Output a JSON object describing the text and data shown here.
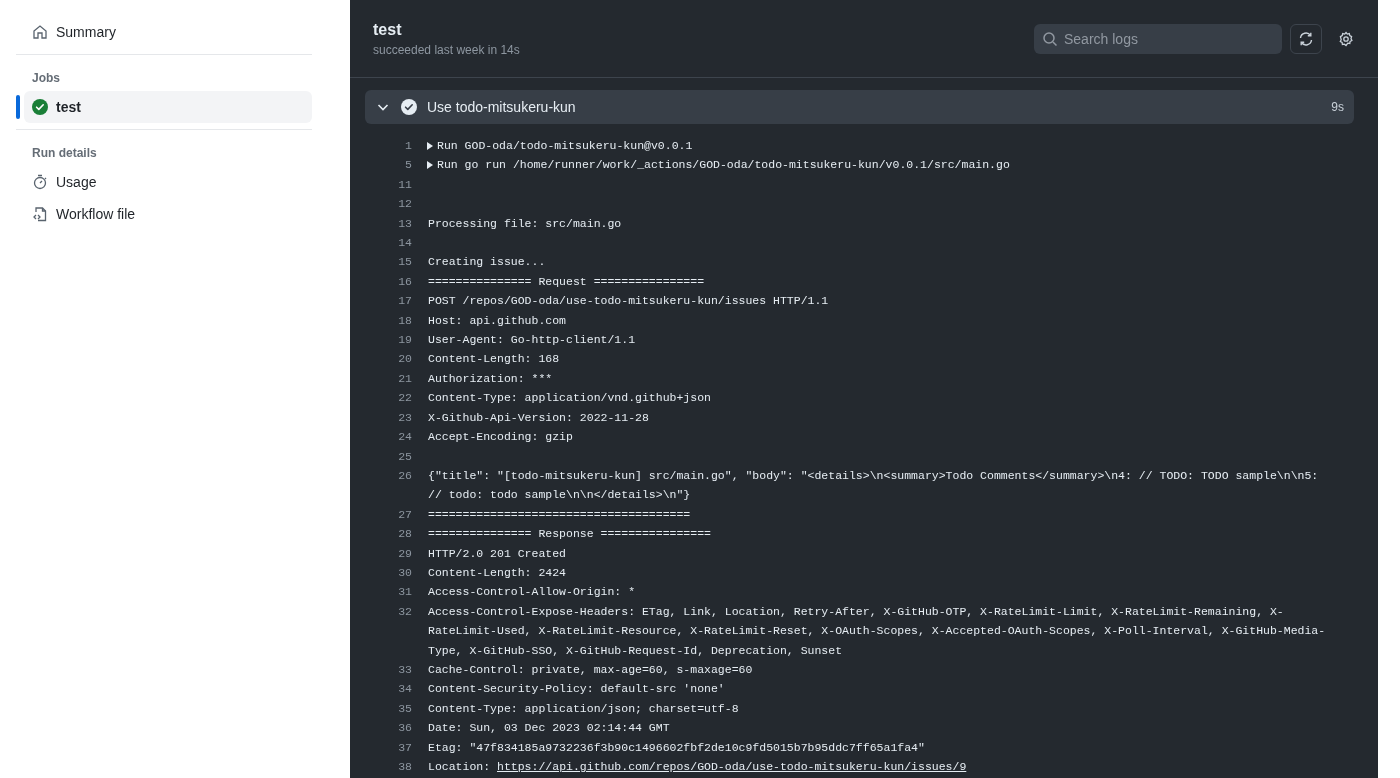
{
  "sidebar": {
    "summary": "Summary",
    "jobs_heading": "Jobs",
    "jobs": [
      {
        "label": "test",
        "selected": true
      }
    ],
    "run_details_heading": "Run details",
    "details": [
      {
        "label": "Usage",
        "kind": "stopwatch"
      },
      {
        "label": "Workflow file",
        "kind": "file"
      }
    ]
  },
  "header": {
    "title": "test",
    "subtitle": "succeeded last week in 14s",
    "search": {
      "placeholder": "Search logs"
    }
  },
  "step": {
    "name": "Use todo-mitsukeru-kun",
    "duration": "9s",
    "expanded": true
  },
  "log": [
    {
      "num": "1",
      "kind": "group",
      "text": "Run GOD-oda/todo-mitsukeru-kun@v0.0.1"
    },
    {
      "num": "5",
      "kind": "group",
      "text": "Run go run /home/runner/work/_actions/GOD-oda/todo-mitsukeru-kun/v0.0.1/src/main.go"
    },
    {
      "num": "11",
      "kind": "line"
    },
    {
      "num": "12",
      "kind": "line"
    },
    {
      "num": "13",
      "kind": "line",
      "text": "Processing file: src/main.go"
    },
    {
      "num": "14",
      "kind": "line"
    },
    {
      "num": "15",
      "kind": "line",
      "text": "Creating issue..."
    },
    {
      "num": "16",
      "kind": "line",
      "text": "=============== Request ================"
    },
    {
      "num": "17",
      "kind": "line",
      "text": "POST /repos/GOD-oda/use-todo-mitsukeru-kun/issues HTTP/1.1"
    },
    {
      "num": "18",
      "kind": "line",
      "text": "Host: api.github.com"
    },
    {
      "num": "19",
      "kind": "line",
      "text": "User-Agent: Go-http-client/1.1"
    },
    {
      "num": "20",
      "kind": "line",
      "text": "Content-Length: 168"
    },
    {
      "num": "21",
      "kind": "line",
      "text": "Authorization: ***"
    },
    {
      "num": "22",
      "kind": "line",
      "text": "Content-Type: application/vnd.github+json"
    },
    {
      "num": "23",
      "kind": "line",
      "text": "X-Github-Api-Version: 2022-11-28"
    },
    {
      "num": "24",
      "kind": "line",
      "text": "Accept-Encoding: gzip"
    },
    {
      "num": "25",
      "kind": "line"
    },
    {
      "num": "26",
      "kind": "line",
      "text": "{\"title\": \"[todo-mitsukeru-kun] src/main.go\", \"body\": \"<details>\\n<summary>Todo Comments</summary>\\n4: // TODO: TODO sample\\n\\n5: // todo: todo sample\\n\\n</details>\\n\"}"
    },
    {
      "num": "27",
      "kind": "line",
      "text": "======================================"
    },
    {
      "num": "28",
      "kind": "line",
      "text": "=============== Response ================"
    },
    {
      "num": "29",
      "kind": "line",
      "text": "HTTP/2.0 201 Created"
    },
    {
      "num": "30",
      "kind": "line",
      "text": "Content-Length: 2424"
    },
    {
      "num": "31",
      "kind": "line",
      "text": "Access-Control-Allow-Origin: *"
    },
    {
      "num": "32",
      "kind": "line",
      "text": "Access-Control-Expose-Headers: ETag, Link, Location, Retry-After, X-GitHub-OTP, X-RateLimit-Limit, X-RateLimit-Remaining, X-RateLimit-Used, X-RateLimit-Resource, X-RateLimit-Reset, X-OAuth-Scopes, X-Accepted-OAuth-Scopes, X-Poll-Interval, X-GitHub-Media-Type, X-GitHub-SSO, X-GitHub-Request-Id, Deprecation, Sunset"
    },
    {
      "num": "33",
      "kind": "line",
      "text": "Cache-Control: private, max-age=60, s-maxage=60"
    },
    {
      "num": "34",
      "kind": "line",
      "text": "Content-Security-Policy: default-src 'none'"
    },
    {
      "num": "35",
      "kind": "line",
      "text": "Content-Type: application/json; charset=utf-8"
    },
    {
      "num": "36",
      "kind": "line",
      "text": "Date: Sun, 03 Dec 2023 02:14:44 GMT"
    },
    {
      "num": "37",
      "kind": "line",
      "text": "Etag: \"47f834185a9732236f3b90c1496602fbf2de10c9fd5015b7b95ddc7ff65a1fa4\""
    },
    {
      "num": "38",
      "kind": "link",
      "text": "Location: ",
      "link": "https://api.github.com/repos/GOD-oda/use-todo-mitsukeru-kun/issues/9"
    }
  ]
}
